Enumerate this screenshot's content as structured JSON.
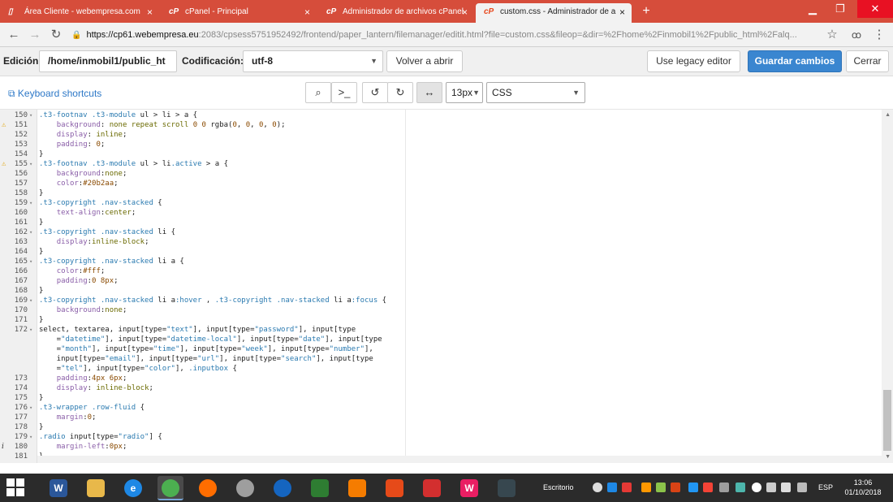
{
  "browser": {
    "tabs": [
      {
        "label": "Área Cliente - webempresa.com",
        "favicon": "page-icon",
        "active": false
      },
      {
        "label": "cPanel - Principal",
        "favicon": "cpanel-icon",
        "active": false
      },
      {
        "label": "Administrador de archivos cPanel",
        "favicon": "cpanel-icon",
        "active": false
      },
      {
        "label": "custom.css - Administrador de a",
        "favicon": "cpanel-icon",
        "active": true
      }
    ],
    "close_glyph": "×",
    "new_tab": "+",
    "url_host": "https://cp61.webempresa.eu",
    "url_path": ":2083/cpsess5751952492/frontend/paper_lantern/filemanager/editit.html?file=custom.css&fileop=&dir=%2Fhome%2Finmobil1%2Fpublic_html%2Falq...",
    "accent": "#d64d3b"
  },
  "header": {
    "edition_label": "Edición:",
    "path_value": "/home/inmobil1/public_ht",
    "encoding_label": "Codificación:",
    "encoding_value": "utf-8",
    "reopen_button": "Volver a abrir",
    "legacy_button": "Use legacy editor",
    "save_button": "Guardar cambios",
    "close_button": "Cerrar"
  },
  "toolbar": {
    "shortcuts_label": "Keyboard shortcuts",
    "font_size": "13px",
    "mode": "CSS"
  },
  "editor": {
    "lines": [
      {
        "n": "150",
        "fold": true,
        "mark": "",
        "t": [
          {
            "c": "sel",
            "v": ".t3-footnav .t3-module"
          },
          {
            "c": "",
            "v": " ul > li > a {"
          }
        ]
      },
      {
        "n": "151",
        "fold": false,
        "mark": "warn",
        "t": [
          {
            "c": "",
            "v": "    "
          },
          {
            "c": "prop",
            "v": "background"
          },
          {
            "c": "",
            "v": ": "
          },
          {
            "c": "val",
            "v": "none repeat scroll"
          },
          {
            "c": "",
            "v": " "
          },
          {
            "c": "num",
            "v": "0 0"
          },
          {
            "c": "",
            "v": " rgba("
          },
          {
            "c": "num",
            "v": "0"
          },
          {
            "c": "",
            "v": ", "
          },
          {
            "c": "num",
            "v": "0"
          },
          {
            "c": "",
            "v": ", "
          },
          {
            "c": "num",
            "v": "0"
          },
          {
            "c": "",
            "v": ", "
          },
          {
            "c": "num",
            "v": "0"
          },
          {
            "c": "",
            "v": ");"
          }
        ]
      },
      {
        "n": "152",
        "fold": false,
        "mark": "",
        "t": [
          {
            "c": "",
            "v": "    "
          },
          {
            "c": "prop",
            "v": "display"
          },
          {
            "c": "",
            "v": ": "
          },
          {
            "c": "val",
            "v": "inline"
          },
          {
            "c": "",
            "v": ";"
          }
        ]
      },
      {
        "n": "153",
        "fold": false,
        "mark": "",
        "t": [
          {
            "c": "",
            "v": "    "
          },
          {
            "c": "prop",
            "v": "padding"
          },
          {
            "c": "",
            "v": ": "
          },
          {
            "c": "num",
            "v": "0"
          },
          {
            "c": "",
            "v": ";"
          }
        ]
      },
      {
        "n": "154",
        "fold": false,
        "mark": "",
        "t": [
          {
            "c": "",
            "v": "}"
          }
        ]
      },
      {
        "n": "155",
        "fold": true,
        "mark": "warn",
        "t": [
          {
            "c": "sel",
            "v": ".t3-footnav .t3-module"
          },
          {
            "c": "",
            "v": " ul > li"
          },
          {
            "c": "sel",
            "v": ".active"
          },
          {
            "c": "",
            "v": " > a {"
          }
        ]
      },
      {
        "n": "156",
        "fold": false,
        "mark": "",
        "t": [
          {
            "c": "",
            "v": "    "
          },
          {
            "c": "prop",
            "v": "background"
          },
          {
            "c": "",
            "v": ":"
          },
          {
            "c": "val",
            "v": "none"
          },
          {
            "c": "",
            "v": ";"
          }
        ]
      },
      {
        "n": "157",
        "fold": false,
        "mark": "",
        "t": [
          {
            "c": "",
            "v": "    "
          },
          {
            "c": "prop",
            "v": "color"
          },
          {
            "c": "",
            "v": ":"
          },
          {
            "c": "num",
            "v": "#20b2aa"
          },
          {
            "c": "",
            "v": ";"
          }
        ]
      },
      {
        "n": "158",
        "fold": false,
        "mark": "",
        "t": [
          {
            "c": "",
            "v": "}"
          }
        ]
      },
      {
        "n": "159",
        "fold": true,
        "mark": "",
        "t": [
          {
            "c": "sel",
            "v": ".t3-copyright .nav-stacked"
          },
          {
            "c": "",
            "v": " {"
          }
        ]
      },
      {
        "n": "160",
        "fold": false,
        "mark": "",
        "t": [
          {
            "c": "",
            "v": "    "
          },
          {
            "c": "prop",
            "v": "text-align"
          },
          {
            "c": "",
            "v": ":"
          },
          {
            "c": "val",
            "v": "center"
          },
          {
            "c": "",
            "v": ";"
          }
        ]
      },
      {
        "n": "161",
        "fold": false,
        "mark": "",
        "t": [
          {
            "c": "",
            "v": "}"
          }
        ]
      },
      {
        "n": "162",
        "fold": true,
        "mark": "",
        "t": [
          {
            "c": "sel",
            "v": ".t3-copyright .nav-stacked"
          },
          {
            "c": "",
            "v": " li {"
          }
        ]
      },
      {
        "n": "163",
        "fold": false,
        "mark": "",
        "t": [
          {
            "c": "",
            "v": "    "
          },
          {
            "c": "prop",
            "v": "display"
          },
          {
            "c": "",
            "v": ":"
          },
          {
            "c": "val",
            "v": "inline-block"
          },
          {
            "c": "",
            "v": ";"
          }
        ]
      },
      {
        "n": "164",
        "fold": false,
        "mark": "",
        "t": [
          {
            "c": "",
            "v": "}"
          }
        ]
      },
      {
        "n": "165",
        "fold": true,
        "mark": "",
        "t": [
          {
            "c": "sel",
            "v": ".t3-copyright .nav-stacked"
          },
          {
            "c": "",
            "v": " li a {"
          }
        ]
      },
      {
        "n": "166",
        "fold": false,
        "mark": "",
        "t": [
          {
            "c": "",
            "v": "    "
          },
          {
            "c": "prop",
            "v": "color"
          },
          {
            "c": "",
            "v": ":"
          },
          {
            "c": "num",
            "v": "#fff"
          },
          {
            "c": "",
            "v": ";"
          }
        ]
      },
      {
        "n": "167",
        "fold": false,
        "mark": "",
        "t": [
          {
            "c": "",
            "v": "    "
          },
          {
            "c": "prop",
            "v": "padding"
          },
          {
            "c": "",
            "v": ":"
          },
          {
            "c": "num",
            "v": "0 8px"
          },
          {
            "c": "",
            "v": ";"
          }
        ]
      },
      {
        "n": "168",
        "fold": false,
        "mark": "",
        "t": [
          {
            "c": "",
            "v": "}"
          }
        ]
      },
      {
        "n": "169",
        "fold": true,
        "mark": "",
        "t": [
          {
            "c": "sel",
            "v": ".t3-copyright .nav-stacked"
          },
          {
            "c": "",
            "v": " li a"
          },
          {
            "c": "sel",
            "v": ":hover"
          },
          {
            "c": "",
            "v": " , "
          },
          {
            "c": "sel",
            "v": ".t3-copyright .nav-stacked"
          },
          {
            "c": "",
            "v": " li a"
          },
          {
            "c": "sel",
            "v": ":focus"
          },
          {
            "c": "",
            "v": " {"
          }
        ]
      },
      {
        "n": "170",
        "fold": false,
        "mark": "",
        "t": [
          {
            "c": "",
            "v": "    "
          },
          {
            "c": "prop",
            "v": "background"
          },
          {
            "c": "",
            "v": ":"
          },
          {
            "c": "val",
            "v": "none"
          },
          {
            "c": "",
            "v": ";"
          }
        ]
      },
      {
        "n": "171",
        "fold": false,
        "mark": "",
        "t": [
          {
            "c": "",
            "v": "}"
          }
        ]
      },
      {
        "n": "172",
        "fold": true,
        "mark": "",
        "t": [
          {
            "c": "",
            "v": "select, textarea, input[type="
          },
          {
            "c": "str",
            "v": "\"text\""
          },
          {
            "c": "",
            "v": "], input[type="
          },
          {
            "c": "str",
            "v": "\"password\""
          },
          {
            "c": "",
            "v": "], input[type"
          }
        ]
      },
      {
        "n": "",
        "fold": false,
        "mark": "",
        "t": [
          {
            "c": "",
            "v": "    ="
          },
          {
            "c": "str",
            "v": "\"datetime\""
          },
          {
            "c": "",
            "v": "], input[type="
          },
          {
            "c": "str",
            "v": "\"datetime-local\""
          },
          {
            "c": "",
            "v": "], input[type="
          },
          {
            "c": "str",
            "v": "\"date\""
          },
          {
            "c": "",
            "v": "], input[type"
          }
        ]
      },
      {
        "n": "",
        "fold": false,
        "mark": "",
        "t": [
          {
            "c": "",
            "v": "    ="
          },
          {
            "c": "str",
            "v": "\"month\""
          },
          {
            "c": "",
            "v": "], input[type="
          },
          {
            "c": "str",
            "v": "\"time\""
          },
          {
            "c": "",
            "v": "], input[type="
          },
          {
            "c": "str",
            "v": "\"week\""
          },
          {
            "c": "",
            "v": "], input[type="
          },
          {
            "c": "str",
            "v": "\"number\""
          },
          {
            "c": "",
            "v": "],"
          }
        ]
      },
      {
        "n": "",
        "fold": false,
        "mark": "",
        "t": [
          {
            "c": "",
            "v": "    input[type="
          },
          {
            "c": "str",
            "v": "\"email\""
          },
          {
            "c": "",
            "v": "], input[type="
          },
          {
            "c": "str",
            "v": "\"url\""
          },
          {
            "c": "",
            "v": "], input[type="
          },
          {
            "c": "str",
            "v": "\"search\""
          },
          {
            "c": "",
            "v": "], input[type"
          }
        ]
      },
      {
        "n": "",
        "fold": false,
        "mark": "",
        "t": [
          {
            "c": "",
            "v": "    ="
          },
          {
            "c": "str",
            "v": "\"tel\""
          },
          {
            "c": "",
            "v": "], input[type="
          },
          {
            "c": "str",
            "v": "\"color\""
          },
          {
            "c": "",
            "v": "], "
          },
          {
            "c": "sel",
            "v": ".inputbox"
          },
          {
            "c": "",
            "v": " {"
          }
        ]
      },
      {
        "n": "173",
        "fold": false,
        "mark": "",
        "t": [
          {
            "c": "",
            "v": "    "
          },
          {
            "c": "prop",
            "v": "padding"
          },
          {
            "c": "",
            "v": ":"
          },
          {
            "c": "num",
            "v": "4px 6px"
          },
          {
            "c": "",
            "v": ";"
          }
        ]
      },
      {
        "n": "174",
        "fold": false,
        "mark": "",
        "t": [
          {
            "c": "",
            "v": "    "
          },
          {
            "c": "prop",
            "v": "display"
          },
          {
            "c": "",
            "v": ": "
          },
          {
            "c": "val",
            "v": "inline-block"
          },
          {
            "c": "",
            "v": ";"
          }
        ]
      },
      {
        "n": "175",
        "fold": false,
        "mark": "",
        "t": [
          {
            "c": "",
            "v": "}"
          }
        ]
      },
      {
        "n": "176",
        "fold": true,
        "mark": "",
        "t": [
          {
            "c": "sel",
            "v": ".t3-wrapper .row-fluid"
          },
          {
            "c": "",
            "v": " {"
          }
        ]
      },
      {
        "n": "177",
        "fold": false,
        "mark": "",
        "t": [
          {
            "c": "",
            "v": "    "
          },
          {
            "c": "prop",
            "v": "margin"
          },
          {
            "c": "",
            "v": ":"
          },
          {
            "c": "num",
            "v": "0"
          },
          {
            "c": "",
            "v": ";"
          }
        ]
      },
      {
        "n": "178",
        "fold": false,
        "mark": "",
        "t": [
          {
            "c": "",
            "v": "}"
          }
        ]
      },
      {
        "n": "179",
        "fold": true,
        "mark": "",
        "t": [
          {
            "c": "sel",
            "v": ".radio"
          },
          {
            "c": "",
            "v": " input[type="
          },
          {
            "c": "str",
            "v": "\"radio\""
          },
          {
            "c": "",
            "v": "] {"
          }
        ]
      },
      {
        "n": "180",
        "fold": false,
        "mark": "info",
        "t": [
          {
            "c": "",
            "v": "    "
          },
          {
            "c": "prop",
            "v": "margin-left"
          },
          {
            "c": "",
            "v": ":"
          },
          {
            "c": "num",
            "v": "0px"
          },
          {
            "c": "",
            "v": ";"
          }
        ]
      },
      {
        "n": "181",
        "fold": false,
        "mark": "",
        "t": [
          {
            "c": "",
            "v": "}"
          }
        ]
      }
    ]
  },
  "taskbar": {
    "desktop_label": "Escritorio",
    "language": "ESP",
    "time": "13:06",
    "date": "01/10/2018",
    "apps": [
      {
        "name": "word-icon",
        "glyph": "W",
        "color": "#2b579a"
      },
      {
        "name": "file-explorer-icon",
        "glyph": "",
        "color": "#e8b84a"
      },
      {
        "name": "internet-explorer-icon",
        "glyph": "e",
        "color": "#1e88e5"
      },
      {
        "name": "chrome-icon",
        "glyph": "",
        "color": "#4caf50"
      },
      {
        "name": "firefox-icon",
        "glyph": "",
        "color": "#ff6d00"
      },
      {
        "name": "pro-app-icon",
        "glyph": "",
        "color": "#9e9e9e"
      },
      {
        "name": "thunderbird-icon",
        "glyph": "",
        "color": "#1565c0"
      },
      {
        "name": "store-icon",
        "glyph": "",
        "color": "#2e7d32"
      },
      {
        "name": "settings-app-icon",
        "glyph": "",
        "color": "#f57c00"
      },
      {
        "name": "calendar-app-icon",
        "glyph": "",
        "color": "#e64a19"
      },
      {
        "name": "cube-app-icon",
        "glyph": "",
        "color": "#d32f2f"
      },
      {
        "name": "wamp-icon",
        "glyph": "W",
        "color": "#e91e63"
      },
      {
        "name": "dark-app-icon",
        "glyph": "",
        "color": "#37474f"
      }
    ]
  }
}
